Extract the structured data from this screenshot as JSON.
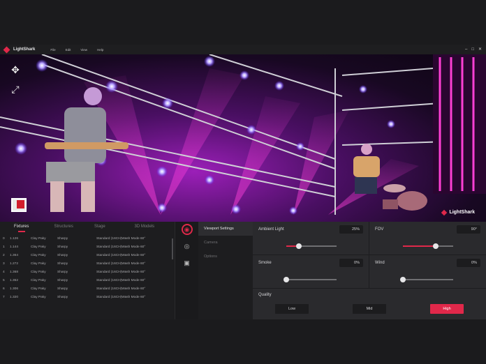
{
  "app": {
    "title": "LightShark"
  },
  "menu": [
    "File",
    "Edit",
    "View",
    "Help"
  ],
  "window_controls": [
    "–",
    "□",
    "✕"
  ],
  "viewport": {
    "brand_badge": "LightShark"
  },
  "fixtures_panel": {
    "tabs": [
      "Fixtures",
      "Structures",
      "Stage",
      "3D Models"
    ],
    "active_tab": "Fixtures",
    "rows": [
      [
        "0",
        "1.126",
        "Clay Paky",
        "Sharpy",
        "Standard (16CH)Wash Mode 60°"
      ],
      [
        "1",
        "1.144",
        "Clay Paky",
        "Sharpy",
        "Standard (16CH)Wash Mode 60°"
      ],
      [
        "2",
        "1.364",
        "Clay Paky",
        "Sharpy",
        "Standard (16CH)Wash Mode 60°"
      ],
      [
        "3",
        "1.272",
        "Clay Paky",
        "Sharpy",
        "Standard (16CH)Wash Mode 60°"
      ],
      [
        "4",
        "1.368",
        "Clay Paky",
        "Sharpy",
        "Standard (16CH)Wash Mode 60°"
      ],
      [
        "5",
        "1.352",
        "Clay Paky",
        "Sharpy",
        "Standard (16CH)Wash Mode 60°"
      ],
      [
        "6",
        "1.306",
        "Clay Paky",
        "Sharpy",
        "Standard (16CH)Wash Mode 60°"
      ],
      [
        "7",
        "1.320",
        "Clay Paky",
        "Sharpy",
        "Standard (16CH)Wash Mode 60°"
      ]
    ]
  },
  "settings_menu": [
    "Viewport Settings",
    "Camera",
    "Options"
  ],
  "settings": {
    "ambient_light": {
      "label": "Ambient Light",
      "value": "25%",
      "level": 0.25
    },
    "fov": {
      "label": "FOV",
      "value": "90°",
      "level": 0.65
    },
    "smoke": {
      "label": "Smoke",
      "value": "0%",
      "level": 0
    },
    "wind": {
      "label": "Wind",
      "value": "0%",
      "level": 0
    },
    "quality": {
      "label": "Quality",
      "options": [
        "Low",
        "Mid",
        "High"
      ],
      "selected": "High"
    }
  },
  "colors": {
    "accent": "#e0284a",
    "panel": "#2a2a2d",
    "background": "#1b1b1d"
  }
}
